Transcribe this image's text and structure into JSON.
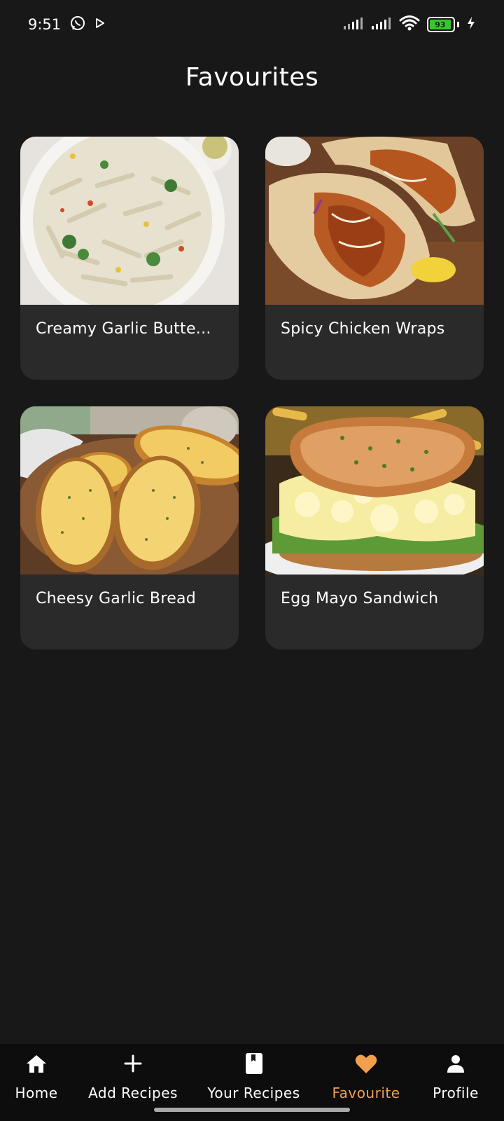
{
  "status_bar": {
    "time": "9:51",
    "battery_percent": "93",
    "battery_level": 0.93
  },
  "header": {
    "title": "Favourites"
  },
  "recipes": [
    {
      "title": "Creamy Garlic Butte..."
    },
    {
      "title": "Spicy Chicken Wraps"
    },
    {
      "title": "Cheesy Garlic Bread"
    },
    {
      "title": "Egg Mayo Sandwich"
    }
  ],
  "bottom_nav": {
    "items": [
      {
        "label": "Home",
        "icon": "home-icon"
      },
      {
        "label": "Add Recipes",
        "icon": "plus-icon"
      },
      {
        "label": "Your Recipes",
        "icon": "book-icon"
      },
      {
        "label": "Favourite",
        "icon": "heart-icon"
      },
      {
        "label": "Profile",
        "icon": "person-icon"
      }
    ],
    "active": "Favourite"
  },
  "colors": {
    "background": "#181818",
    "card": "#2a2a2a",
    "accent": "#f2a04d",
    "nav_background": "#0d0d0d"
  }
}
